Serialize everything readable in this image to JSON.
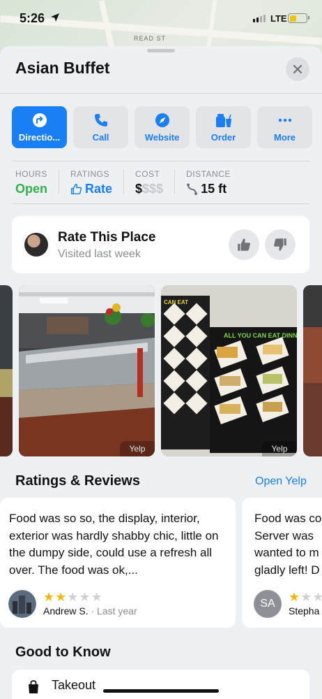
{
  "status_bar": {
    "time": "5:26",
    "network": "LTE"
  },
  "map": {
    "street": "READ ST"
  },
  "place": {
    "name": "Asian Buffet"
  },
  "actions": [
    {
      "label": "Directio...",
      "icon": "directions-icon"
    },
    {
      "label": "Call",
      "icon": "phone-icon"
    },
    {
      "label": "Website",
      "icon": "compass-icon"
    },
    {
      "label": "Order",
      "icon": "takeout-cup-icon"
    },
    {
      "label": "More",
      "icon": "ellipsis-icon"
    }
  ],
  "stats": {
    "hours": {
      "caption": "HOURS",
      "value": "Open"
    },
    "ratings": {
      "caption": "RATINGS",
      "value": "Rate"
    },
    "cost": {
      "caption": "COST",
      "value_active": "$",
      "value_inactive": "$$$"
    },
    "distance": {
      "caption": "DISTANCE",
      "value": "15 ft"
    }
  },
  "rate_place": {
    "title": "Rate This Place",
    "subtitle": "Visited last week"
  },
  "photos": [
    {
      "credit": ""
    },
    {
      "credit": "Yelp"
    },
    {
      "credit": "Yelp",
      "sign_top": "CAN EAT",
      "sign_main": "ALL YOU CAN EAT DINN"
    },
    {
      "credit": ""
    }
  ],
  "ratings_reviews": {
    "title": "Ratings & Reviews",
    "link": "Open Yelp",
    "reviews": [
      {
        "text": "Food was so so, the display, interior, exterior was hardly shabby chic, little on the dumpy side, could use a refresh all over. The food was ok,...",
        "stars": 2,
        "author": "Andrew S.",
        "when": " · Last year"
      },
      {
        "text": "Food was co Server was wanted to m gladly left! D",
        "stars": 1,
        "author": "Stepha",
        "initials": "SA"
      }
    ]
  },
  "good_to_know": {
    "title": "Good to Know",
    "items": [
      {
        "label": "Takeout",
        "icon": "takeout-bag-icon"
      }
    ]
  },
  "colors": {
    "accent": "#1a7ef5",
    "open": "#33b04e",
    "star": "#f5b80f"
  }
}
